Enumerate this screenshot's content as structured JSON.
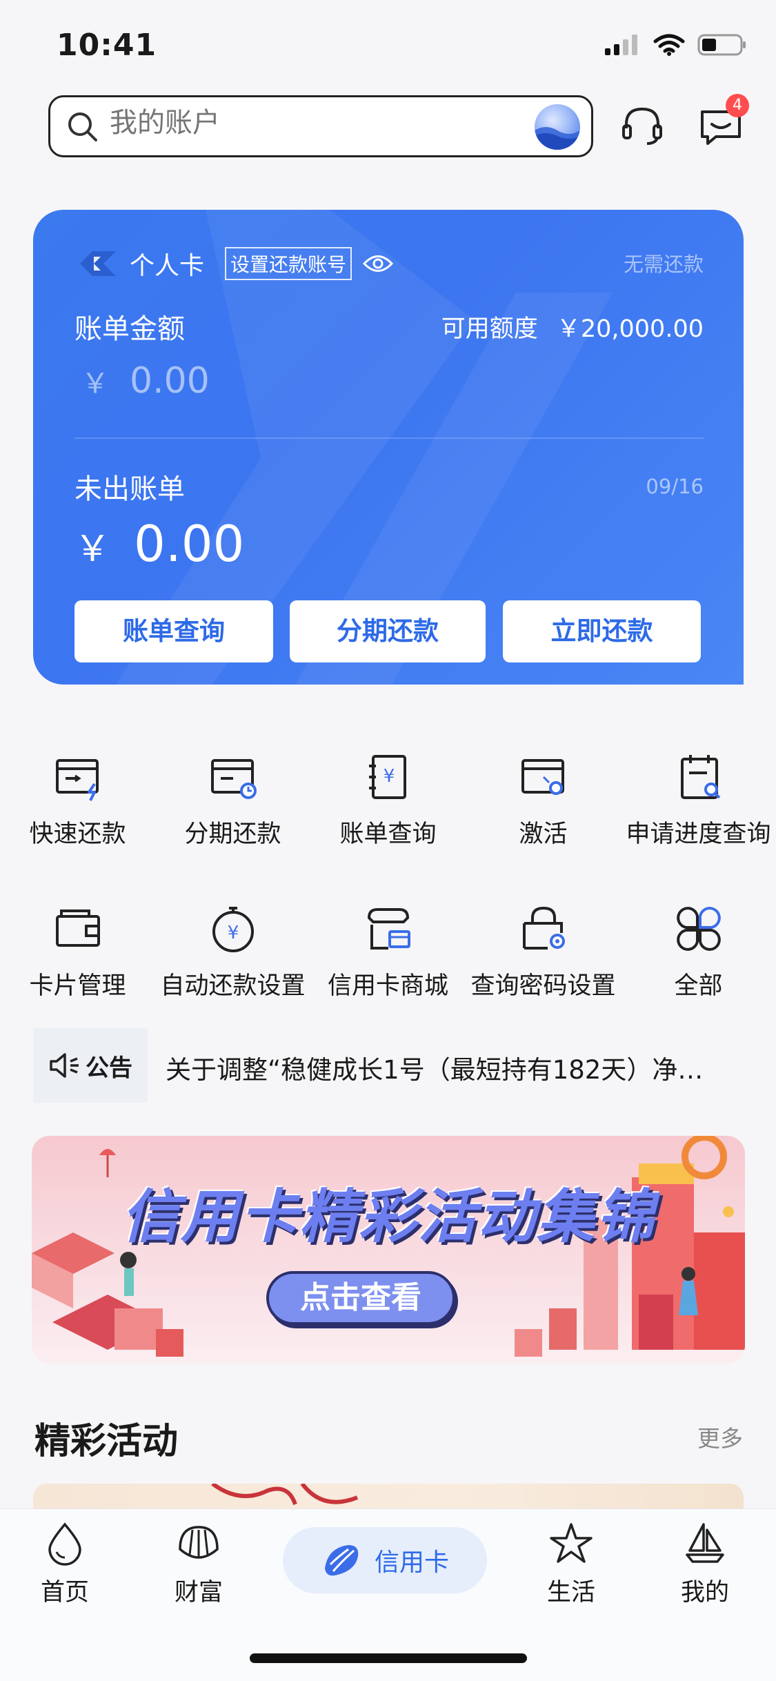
{
  "status_bar": {
    "time": "10:41"
  },
  "search": {
    "placeholder": "我的账户"
  },
  "header": {
    "message_badge": "4"
  },
  "card": {
    "type_label": "个人卡",
    "set_repay_account": "设置还款账号",
    "repay_status": "无需还款",
    "bill_label": "账单金额",
    "credit_label": "可用额度",
    "credit_value": "￥20,000.00",
    "currency": "￥",
    "bill_amount": "0.00",
    "unbilled_label": "未出账单",
    "unbilled_date": "09/16",
    "unbilled_amount": "0.00",
    "buttons": [
      "账单查询",
      "分期还款",
      "立即还款"
    ]
  },
  "grid": [
    {
      "label": "快速还款",
      "icon": "quick-repay-icon"
    },
    {
      "label": "分期还款",
      "icon": "installment-icon"
    },
    {
      "label": "账单查询",
      "icon": "bill-query-icon"
    },
    {
      "label": "激活",
      "icon": "activate-icon"
    },
    {
      "label": "申请进度查询",
      "icon": "application-progress-icon"
    },
    {
      "label": "卡片管理",
      "icon": "card-manage-icon"
    },
    {
      "label": "自动还款设置",
      "icon": "auto-repay-icon"
    },
    {
      "label": "信用卡商城",
      "icon": "mall-icon"
    },
    {
      "label": "查询密码设置",
      "icon": "password-setting-icon"
    },
    {
      "label": "全部",
      "icon": "all-icon"
    }
  ],
  "notice": {
    "tag": "公告",
    "text": "关于调整“稳健成长1号（最短持有182天）净…"
  },
  "banner": {
    "title": "信用卡精彩活动集锦",
    "button": "点击查看"
  },
  "activities": {
    "title": "精彩活动",
    "more": "更多"
  },
  "tabs": [
    {
      "label": "首页",
      "icon": "home-drop-icon"
    },
    {
      "label": "财富",
      "icon": "shell-icon"
    },
    {
      "label": "信用卡",
      "icon": "conch-icon",
      "active": true
    },
    {
      "label": "生活",
      "icon": "starfish-icon"
    },
    {
      "label": "我的",
      "icon": "sailboat-icon"
    }
  ],
  "colors": {
    "primary": "#3b79ef",
    "badge": "#ff4d4f",
    "accent_text": "#2d6ae8"
  }
}
